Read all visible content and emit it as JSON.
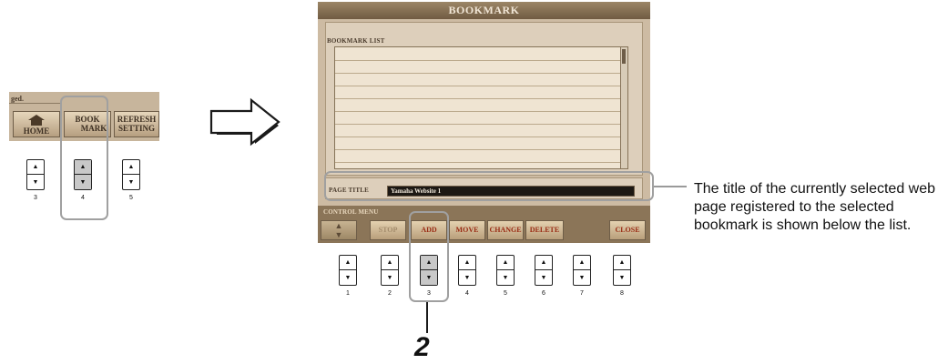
{
  "left_screen": {
    "hint_fragment": "ged.",
    "buttons": [
      {
        "line1": "",
        "line2": "HOME"
      },
      {
        "line1": "BOOK",
        "line2": "MARK"
      },
      {
        "line1": "REFRESH",
        "line2": "SETTING"
      }
    ],
    "panel_numbers": [
      "3",
      "4",
      "5"
    ]
  },
  "arrow_icon": "right-arrow-icon",
  "bookmark_window": {
    "title": "BOOKMARK",
    "list_label": "BOOKMARK LIST",
    "page_title_label": "PAGE TITLE",
    "page_title_value": "Yamaha Website 1",
    "control_menu_label": "CONTROL MENU",
    "buttons": [
      "",
      "STOP",
      "ADD",
      "MOVE",
      "CHANGE",
      "DELETE",
      "",
      "CLOSE"
    ],
    "panel_numbers": [
      "1",
      "2",
      "3",
      "4",
      "5",
      "6",
      "7",
      "8"
    ]
  },
  "callout_text": "The title of the currently selected web page registered to the selected bookmark is shown below the list.",
  "step_number": "2",
  "colors": {
    "screen_bg": "#cdbba3",
    "title_bar": "#705b42",
    "button_text": "#9a2c14",
    "highlight": "#a0a0a0"
  }
}
